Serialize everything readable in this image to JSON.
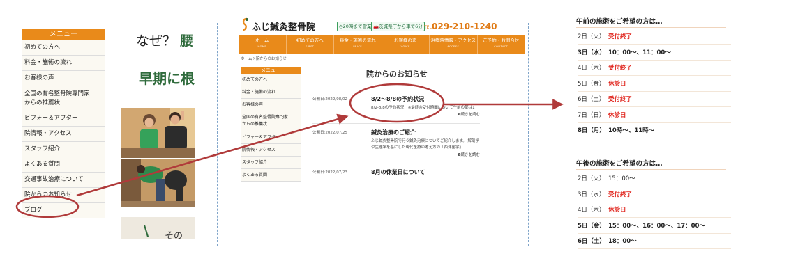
{
  "panel1": {
    "menu_header": "メニュー",
    "menu_items": [
      "初めての方へ",
      "料金・施術の流れ",
      "お客様の声",
      "全国の有名整骨院専門家\nからの推薦状",
      "ビフォー＆アフター",
      "院情報・アクセス",
      "スタッフ紹介",
      "よくある質問",
      "交通事故治療について",
      "院からのお知らせ",
      "ブログ"
    ],
    "fragment_heading1_a": "なぜ？",
    "fragment_heading1_b": "腰",
    "fragment_heading2": "早期に根",
    "fragment_bottom_a": "\\",
    "fragment_bottom_b": "その"
  },
  "panel2": {
    "logo_text": "ふじ鍼灸整骨院",
    "badge_hours": "20時まで営業",
    "badge_car": "茨城県庁から車で6分",
    "tel_label": "TEL",
    "tel": "029-210-1240",
    "nav": [
      {
        "jp": "ホーム",
        "en": "HOME"
      },
      {
        "jp": "初めての方へ",
        "en": "FIRST"
      },
      {
        "jp": "料金・施術の流れ",
        "en": "PRICE"
      },
      {
        "jp": "お客様の声",
        "en": "VOICE"
      },
      {
        "jp": "治療院情報・アクセス",
        "en": "ACCESS"
      },
      {
        "jp": "ご予約・お問合せ",
        "en": "CONTACT"
      }
    ],
    "breadcrumb": "ホーム＞院からのお知らせ",
    "menu_header": "メニュー",
    "menu_items": [
      "初めての方へ",
      "料金・施術の流れ",
      "お客様の声",
      "全国の有名整骨院専門家\nからの推薦状",
      "ビフォー＆アフター",
      "院情報・アクセス",
      "スタッフ紹介",
      "よくある質問"
    ],
    "page_title": "院からのお知らせ",
    "posts": [
      {
        "date": "公開日:2022/08/02",
        "title": "8/2～8/8の予約状況",
        "body": "8/2-8/8の予約状況　※最終の受付時間について午前の部は1",
        "more": "❶続きを読む"
      },
      {
        "date": "公開日:2022/07/25",
        "title": "鍼灸治療のご紹介",
        "body": "ふじ鍼灸整骨院で行う鍼灸治療についてご紹介します。 解剖学や生理学を基にした現代医療の考え方の「西洋医学」…",
        "more": "❶続きを読む"
      },
      {
        "date": "公開日:2022/07/23",
        "title": "8月の休業日について",
        "body": "",
        "more": ""
      }
    ]
  },
  "panel3": {
    "morning_heading": "午前の施術をご希望の方は…",
    "morning": [
      {
        "day": "2日（火）",
        "value": "受付終了",
        "status": "closed",
        "bold": false
      },
      {
        "day": "3日（水）",
        "value": "10：00～、11：00～",
        "status": "open",
        "bold": true
      },
      {
        "day": "4日（木）",
        "value": "受付終了",
        "status": "closed",
        "bold": false
      },
      {
        "day": "5日（金）",
        "value": "休診日",
        "status": "closed",
        "bold": false
      },
      {
        "day": "6日（土）",
        "value": "受付終了",
        "status": "closed",
        "bold": false
      },
      {
        "day": "7日（日）",
        "value": "休診日",
        "status": "closed",
        "bold": false
      },
      {
        "day": "8日（月）",
        "value": "10時～、11時～",
        "status": "open",
        "bold": true
      }
    ],
    "afternoon_heading": "午後の施術をご希望の方は…",
    "afternoon": [
      {
        "day": "2日（火）",
        "value": "15：00～",
        "status": "open",
        "bold": false
      },
      {
        "day": "3日（水）",
        "value": "受付終了",
        "status": "closed",
        "bold": false
      },
      {
        "day": "4日（木）",
        "value": "休診日",
        "status": "closed",
        "bold": false
      },
      {
        "day": "5日（金）",
        "value": "15：00～、16：00～、17：00～",
        "status": "open",
        "bold": true
      },
      {
        "day": "6日（土）",
        "value": "18：00～",
        "status": "open",
        "bold": true
      }
    ]
  },
  "colors": {
    "accent": "#e98a1a",
    "annotation": "#b03a3a",
    "closed": "#e0241c",
    "green": "#2f6b3c"
  }
}
